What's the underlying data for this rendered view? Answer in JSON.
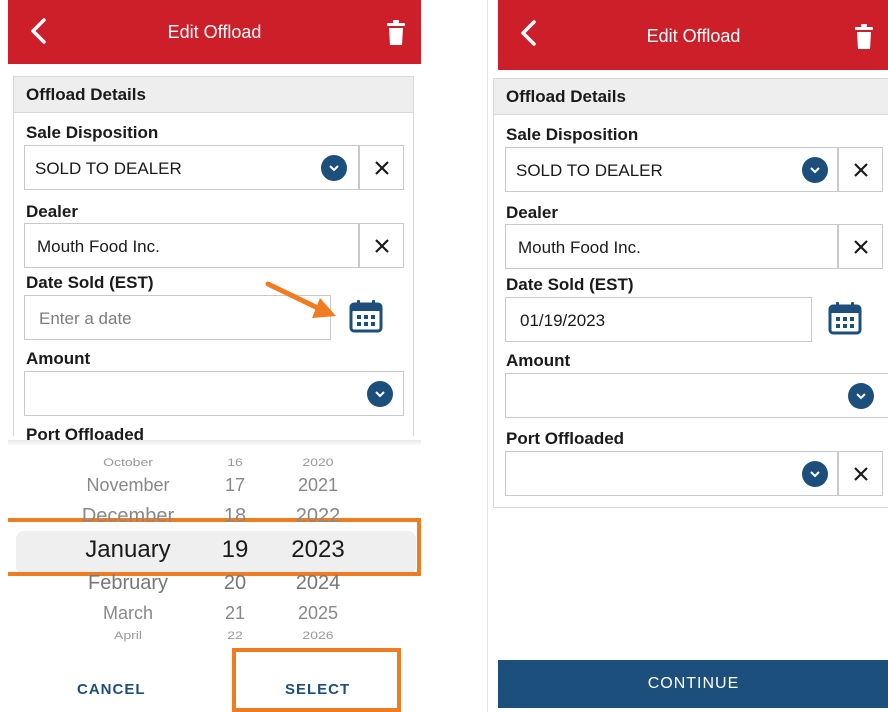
{
  "left": {
    "header": {
      "title": "Edit Offload"
    },
    "card": {
      "title": "Offload Details",
      "sale_disposition_label": "Sale Disposition",
      "sale_disposition_value": "SOLD TO DEALER",
      "dealer_label": "Dealer",
      "dealer_value": "Mouth Food Inc.",
      "date_label": "Date Sold (EST)",
      "date_placeholder": "Enter a date",
      "amount_label": "Amount",
      "amount_value": "",
      "port_label_partial": "Port Offloaded"
    },
    "picker": {
      "months": [
        "October",
        "November",
        "December",
        "January",
        "February",
        "March",
        "April"
      ],
      "days": [
        "16",
        "17",
        "18",
        "19",
        "20",
        "21",
        "22"
      ],
      "years": [
        "2020",
        "2021",
        "2022",
        "2023",
        "2024",
        "2025",
        "2026"
      ],
      "selected": {
        "month": "January",
        "day": "19",
        "year": "2023"
      },
      "cancel_label": "CANCEL",
      "select_label": "SELECT"
    },
    "annotation_color": "#f07c22"
  },
  "right": {
    "header": {
      "title": "Edit Offload"
    },
    "card": {
      "title": "Offload Details",
      "sale_disposition_label": "Sale Disposition",
      "sale_disposition_value": "SOLD TO DEALER",
      "dealer_label": "Dealer",
      "dealer_value": "Mouth Food Inc.",
      "date_label": "Date Sold (EST)",
      "date_value": "01/19/2023",
      "amount_label": "Amount",
      "amount_value": "",
      "port_label": "Port Offloaded",
      "port_value": ""
    },
    "continue_label": "CONTINUE"
  },
  "colors": {
    "header_red": "#cc1f29",
    "primary_blue": "#1d4f7c"
  },
  "icons": [
    "back-chevron-icon",
    "trash-icon",
    "chevron-down-icon",
    "close-icon",
    "calendar-icon",
    "arrow-icon"
  ]
}
